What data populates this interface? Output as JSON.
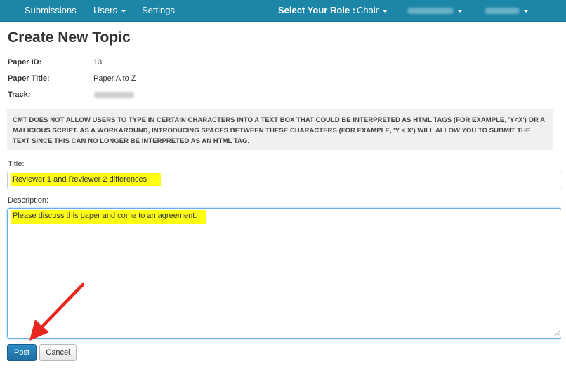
{
  "navbar": {
    "items": [
      {
        "label": "Submissions"
      },
      {
        "label": "Users"
      },
      {
        "label": "Settings"
      }
    ],
    "role_label": "Select Your Role :",
    "role_value": "Chair"
  },
  "page": {
    "title": "Create New Topic"
  },
  "info": {
    "paper_id_label": "Paper ID:",
    "paper_id_value": "13",
    "paper_title_label": "Paper Title:",
    "paper_title_value": "Paper A to Z",
    "track_label": "Track:"
  },
  "notice": {
    "text": "CMT DOES NOT ALLOW USERS TO TYPE IN CERTAIN CHARACTERS INTO A TEXT BOX THAT COULD BE INTERPRETED AS HTML TAGS (FOR EXAMPLE, 'Y<X') OR A MALICIOUS SCRIPT. AS A WORKAROUND, INTRODUCING SPACES BETWEEN THESE CHARACTERS (FOR EXAMPLE, 'Y < X') WILL ALLOW YOU TO SUBMIT THE TEXT SINCE THIS CAN NO LONGER BE INTERPRETED AS AN HTML TAG."
  },
  "form": {
    "title_label": "Title:",
    "title_value": "Reviewer 1 and Reviewer 2 differences",
    "description_label": "Description:",
    "description_value": "Please discuss this paper and come to an agreement.",
    "post_label": "Post",
    "cancel_label": "Cancel"
  },
  "colors": {
    "navbar": "#1b86a8",
    "highlight": "#ffff14",
    "primary_button": "#1f6fa3",
    "annotation_arrow": "#e8271f"
  }
}
